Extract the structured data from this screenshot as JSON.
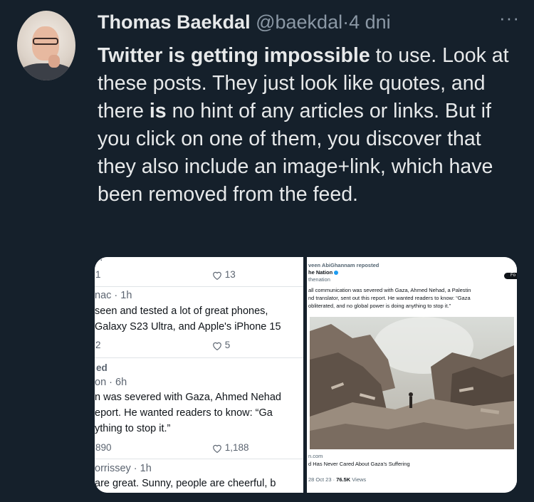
{
  "tweet": {
    "author_name": "Thomas Baekdal",
    "author_handle": "@baekdal",
    "dot": "·",
    "time": "4 dni",
    "more": "···",
    "body_bold_1": "Twitter is getting impossible",
    "body_1": " to use. Look at these posts. They just look like quotes, and there ",
    "body_bold_2": "is",
    "body_2": " no hint of any articles or links. But if you click on one of them, you discover that they also include an image+link, which have been removed from the feed."
  },
  "left_panel": {
    "row1_stat1": "1",
    "row1_likes": "13",
    "row2_header": "nac · 1h",
    "row2_line1": "seen and tested a lot of great phones,",
    "row2_line2": "Galaxy S23 Ultra, and Apple's iPhone 15",
    "row2_stat1": "2",
    "row2_likes": "5",
    "row3_social": "ed",
    "row3_header": "on · 6h",
    "row3_line1": "n was severed with Gaza, Ahmed Nehad",
    "row3_line2": "eport. He wanted readers to know: “Ga",
    "row3_line3": "ything to stop it.”",
    "row3_stat1": "890",
    "row3_likes": "1,188",
    "row4_header": "orrissey · 1h",
    "row4_line1": "are great. Sunny, people are cheerful, b"
  },
  "right_panel": {
    "repost": "veen AbiGhannam reposted",
    "account": "he Nation",
    "handle": "thenation",
    "button": "Fo",
    "text1": "all communication was severed with Gaza, Ahmed Nehad, a Palestin",
    "text2": "nd translator, sent out this report. He wanted readers to know: “Gaza",
    "text3": "obliterated, and no global power is doing anything to stop it.”",
    "link_domain": "n.com",
    "link_title": "d Has Never Cared About Gaza's Suffering",
    "date": "28 Oct 23 ·",
    "views_count": "76.5K",
    "views_label": " Views"
  }
}
